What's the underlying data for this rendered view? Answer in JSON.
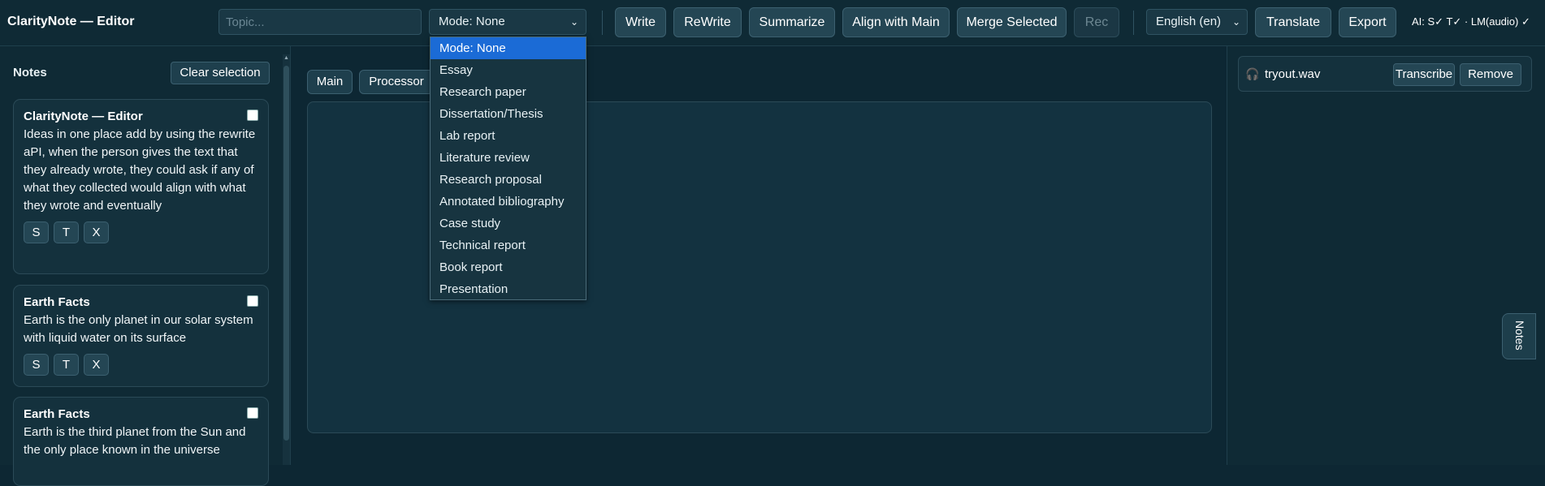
{
  "app": {
    "title": "ClarityNote — Editor"
  },
  "toolbar": {
    "topic_placeholder": "Topic...",
    "mode_value": "Mode: None",
    "buttons": {
      "write": "Write",
      "rewrite": "ReWrite",
      "summarize": "Summarize",
      "align": "Align with Main",
      "merge": "Merge Selected",
      "rec": "Rec",
      "translate": "Translate",
      "export": "Export"
    },
    "language_value": "English (en)",
    "ai_status": "AI: S✓ T✓ · LM(audio) ✓"
  },
  "mode_options": [
    "Mode: None",
    "Essay",
    "Research paper",
    "Dissertation/Thesis",
    "Lab report",
    "Literature review",
    "Research proposal",
    "Annotated bibliography",
    "Case study",
    "Technical report",
    "Book report",
    "Presentation"
  ],
  "sidebar": {
    "title": "Notes",
    "clear_label": "Clear selection",
    "notes": [
      {
        "title": "ClarityNote — Editor",
        "body": "Ideas in one place add by using the rewrite aPI, when the person gives the text that they already wrote, they could ask if any of what they collected would align with what they wrote and eventually",
        "actions": [
          "S",
          "T",
          "X"
        ]
      },
      {
        "title": "Earth Facts",
        "body": "Earth is the only planet in our solar system with liquid water on its surface",
        "actions": [
          "S",
          "T",
          "X"
        ]
      },
      {
        "title": "Earth Facts",
        "body": "Earth is the third planet from the Sun and the only place known in the universe",
        "actions": [
          "S",
          "T",
          "X"
        ]
      }
    ]
  },
  "main": {
    "tabs": [
      "Main",
      "Processor"
    ]
  },
  "right_panel": {
    "audio_file": "tryout.wav",
    "transcribe_label": "Transcribe",
    "remove_label": "Remove",
    "notes_tab_label": "Notes"
  },
  "icons": {
    "audio": "headphones-icon",
    "chevron": "chevron-down-icon"
  },
  "colors": {
    "background": "#0d2733",
    "panel": "#0f2a35",
    "button": "#244654",
    "selected_option": "#1b6bd6"
  }
}
